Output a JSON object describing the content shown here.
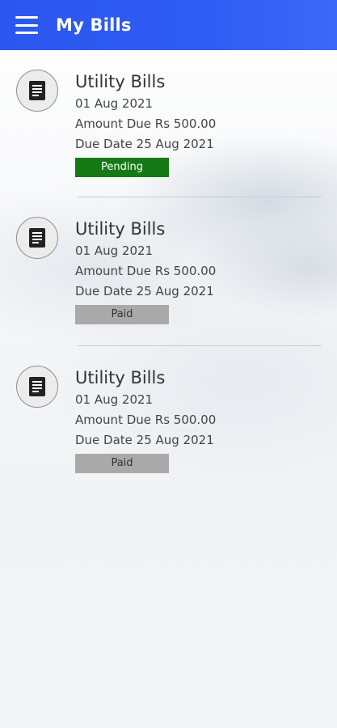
{
  "appbar": {
    "title": "My Bills"
  },
  "colors": {
    "appbar": "#2f5cf3",
    "pending": "#157a15",
    "paid": "#a9a9a9"
  },
  "bills": [
    {
      "icon": "bill-document-icon",
      "title": "Utility Bills",
      "date": "01 Aug 2021",
      "amount": "Amount Due Rs 500.00",
      "due": "Due Date 25 Aug 2021",
      "status": "Pending"
    },
    {
      "icon": "bill-document-icon",
      "title": "Utility Bills",
      "date": "01 Aug 2021",
      "amount": "Amount Due Rs 500.00",
      "due": "Due Date 25 Aug 2021",
      "status": "Paid"
    },
    {
      "icon": "bill-document-icon",
      "title": "Utility Bills",
      "date": "01 Aug 2021",
      "amount": "Amount Due Rs 500.00",
      "due": "Due Date 25 Aug 2021",
      "status": "Paid"
    }
  ]
}
